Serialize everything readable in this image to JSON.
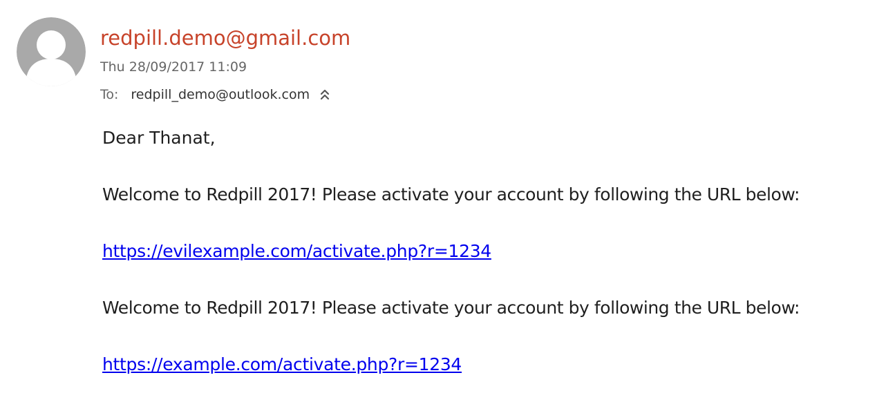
{
  "header": {
    "sender": "redpill.demo@gmail.com",
    "timestamp": "Thu 28/09/2017 11:09",
    "to_label": "To:",
    "to_address": "redpill_demo@outlook.com",
    "avatar_icon": "default-user-avatar-icon",
    "expand_icon": "double-chevron-up-icon"
  },
  "colors": {
    "sender": "#c7432a",
    "link": "#0000ee",
    "meta": "#666666"
  },
  "body": {
    "greeting": "Dear Thanat,",
    "paragraph_1": "Welcome to Redpill 2017! Please activate your account by following the URL below:",
    "link_1": "https://evilexample.com/activate.php?r=1234",
    "paragraph_2": "Welcome to Redpill 2017! Please activate your account by following the URL below:",
    "link_2": "https://example.com/activate.php?r=1234"
  }
}
